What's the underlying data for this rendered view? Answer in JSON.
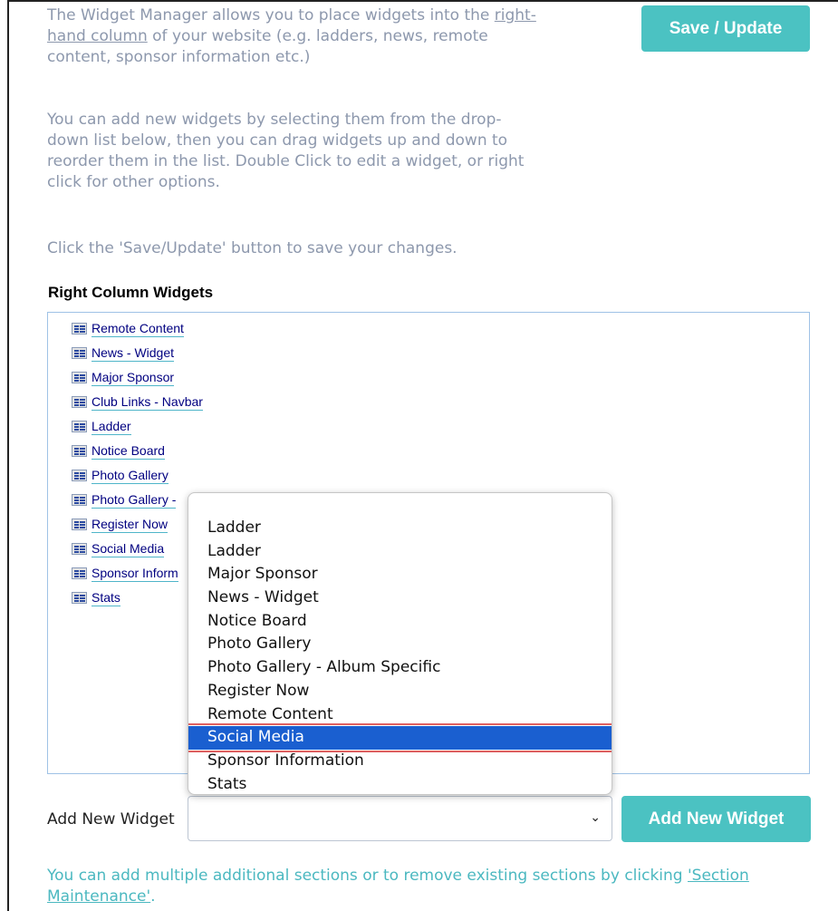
{
  "intro": {
    "p1_before": "The Widget Manager allows you to place widgets into the ",
    "p1_link": "right-hand column",
    "p1_after": " of your website (e.g. ladders, news, remote content, sponsor information etc.)",
    "p2": "You can add new widgets by selecting them from the drop-down list below, then you can drag widgets up and down to reorder them in the list. Double Click to edit a widget, or right click for other options.",
    "p3": "Click the 'Save/Update' button to save your changes."
  },
  "save_button": "Save / Update",
  "section_title": "Right Column Widgets",
  "widgets": [
    "Remote Content",
    "News - Widget",
    "Major Sponsor",
    "Club Links - Navbar",
    "Ladder",
    "Notice Board",
    "Photo Gallery",
    "Photo Gallery -",
    "Register Now",
    "Social Media",
    "Sponsor Inform",
    "Stats"
  ],
  "add_widget": {
    "label": "Add New Widget",
    "selected_value": "",
    "button": "Add New Widget"
  },
  "dropdown_options": [
    "Ladder",
    "Ladder",
    "Major Sponsor",
    "News - Widget",
    "Notice Board",
    "Photo Gallery",
    "Photo Gallery - Album Specific",
    "Register Now",
    "Remote Content",
    "Social Media",
    "Sponsor Information",
    "Stats"
  ],
  "dropdown_selected_index": 9,
  "footer": {
    "text": "You can add multiple additional sections or to remove existing sections by clicking ",
    "link": "'Section Maintenance'",
    "end": "."
  },
  "colors": {
    "accent": "#4bc2c2",
    "intro_text": "#8d98ad",
    "selection": "#1a5fd0",
    "highlight_outline": "#e06060"
  }
}
